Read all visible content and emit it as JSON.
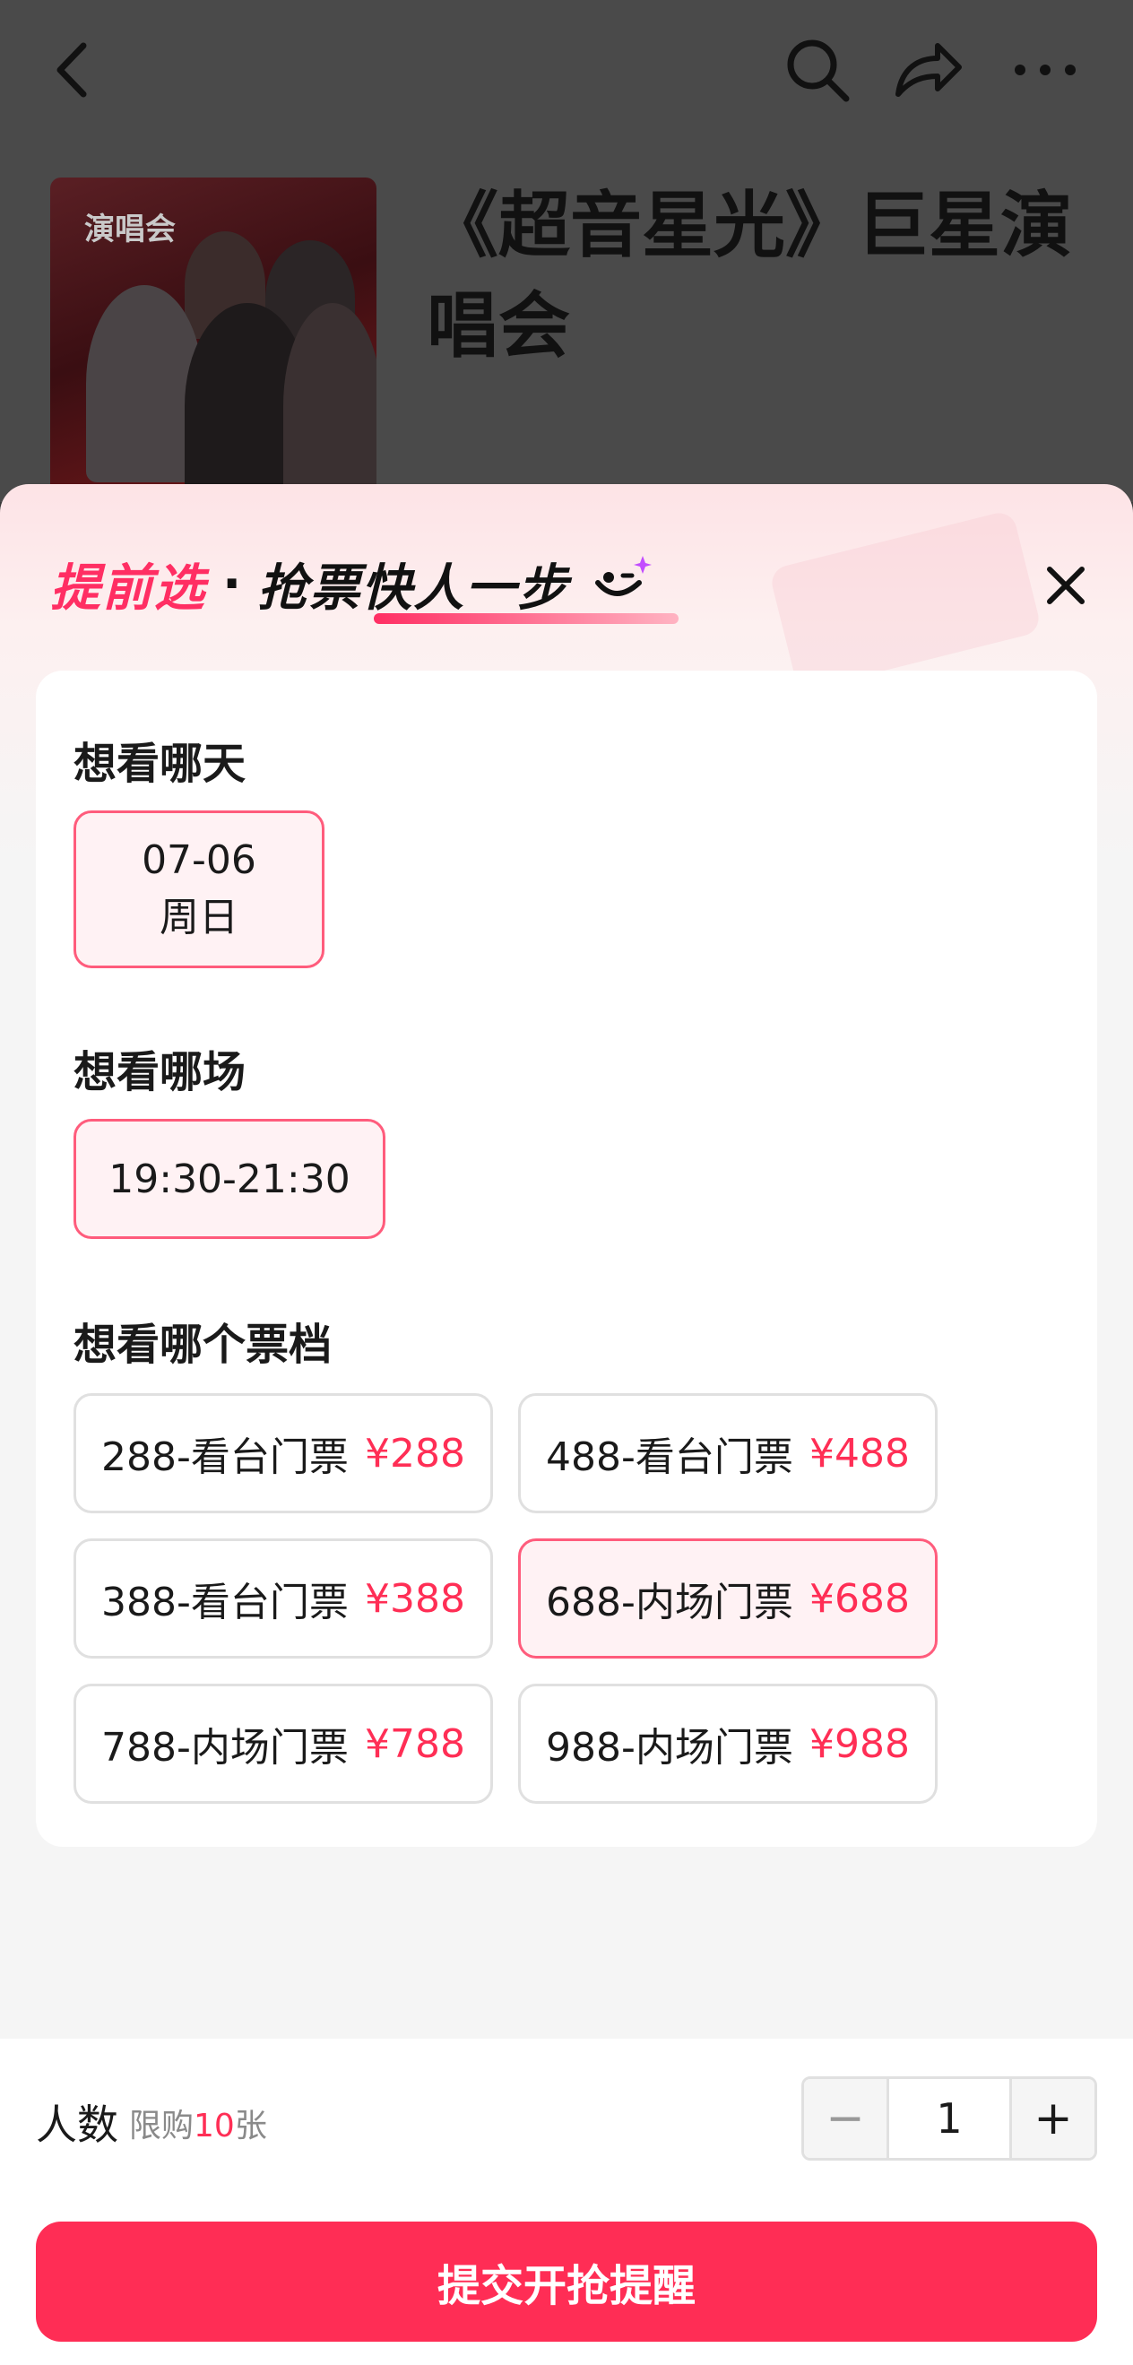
{
  "background": {
    "event_title": "《超音星光》巨星演唱会",
    "poster_tag": "演唱会"
  },
  "topbar": {
    "back_icon": "back-arrow-icon",
    "search_icon": "search-icon",
    "share_icon": "share-icon",
    "more_icon": "more-icon"
  },
  "sheet": {
    "banner_highlight": "提前选",
    "banner_separator": "·",
    "banner_text": "抢票快人一步",
    "close_icon": "close-icon"
  },
  "date_section": {
    "title": "想看哪天",
    "options": [
      {
        "date": "07-06",
        "weekday": "周日",
        "selected": true
      }
    ]
  },
  "session_section": {
    "title": "想看哪场",
    "options": [
      {
        "time": "19:30-21:30",
        "selected": true
      }
    ]
  },
  "tier_section": {
    "title": "想看哪个票档",
    "options": [
      {
        "name": "288-看台门票",
        "price": "¥288",
        "selected": false
      },
      {
        "name": "488-看台门票",
        "price": "¥488",
        "selected": false
      },
      {
        "name": "388-看台门票",
        "price": "¥388",
        "selected": false
      },
      {
        "name": "688-内场门票",
        "price": "¥688",
        "selected": true
      },
      {
        "name": "788-内场门票",
        "price": "¥788",
        "selected": false
      },
      {
        "name": "988-内场门票",
        "price": "¥988",
        "selected": false
      }
    ]
  },
  "quantity": {
    "label": "人数",
    "limit_prefix": "限购",
    "limit_number": "10",
    "limit_suffix": "张",
    "minus": "−",
    "value": "1",
    "plus": "+"
  },
  "submit_label": "提交开抢提醒",
  "colors": {
    "accent": "#ff2d55",
    "selected_border": "#ff5c7c",
    "selected_bg": "#fff2f4"
  }
}
